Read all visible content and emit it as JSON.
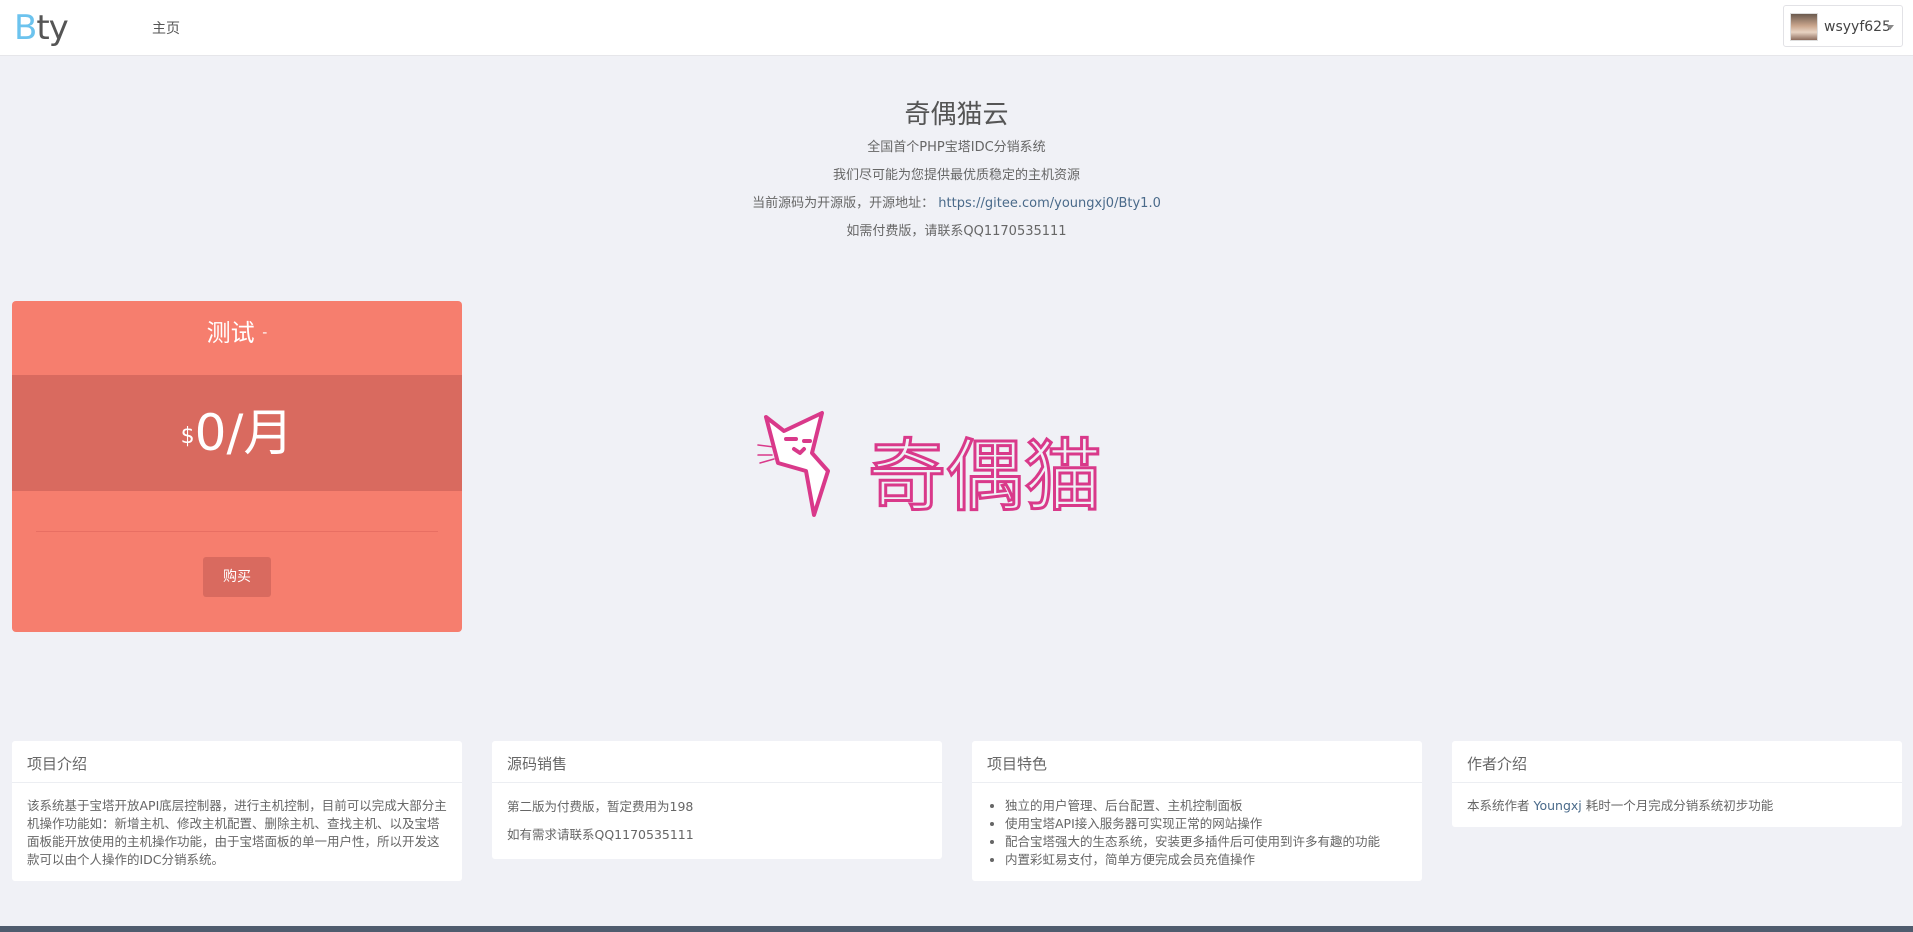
{
  "nav": {
    "logo_b": "B",
    "logo_rest": "ty",
    "home_label": "主页",
    "username": "wsyyf625"
  },
  "hero": {
    "title": "奇偶猫云",
    "line1": "全国首个PHP宝塔IDC分销系统",
    "line2": "我们尽可能为您提供最优质稳定的主机资源",
    "line3_prefix": "当前源码为开源版，开源地址：",
    "line3_link": "https://gitee.com/youngxj0/Bty1.0",
    "line4": "如需付费版，请联系QQ1170535111"
  },
  "price_card": {
    "title": "测试",
    "title_suffix": "-",
    "currency": "$",
    "price": "0/月",
    "buy_label": "购买",
    "colors": {
      "card": "#f67e6e",
      "band": "#d96a5f"
    }
  },
  "brand_logo": {
    "text": "奇偶猫",
    "color": "#d9398a"
  },
  "panels": {
    "intro": {
      "title": "项目介绍",
      "body": "该系统基于宝塔开放API底层控制器，进行主机控制，目前可以完成大部分主机操作功能如：新增主机、修改主机配置、删除主机、查找主机、以及宝塔面板能开放使用的主机操作功能，由于宝塔面板的单一用户性，所以开发这款可以由个人操作的IDC分销系统。"
    },
    "sales": {
      "title": "源码销售",
      "line1": "第二版为付费版，暂定费用为198",
      "line2": "如有需求请联系QQ1170535111"
    },
    "features": {
      "title": "项目特色",
      "items": [
        "独立的用户管理、后台配置、主机控制面板",
        "使用宝塔API接入服务器可实现正常的网站操作",
        "配合宝塔强大的生态系统，安装更多插件后可使用到许多有趣的功能",
        "内置彩虹易支付，简单方便完成会员充值操作"
      ]
    },
    "author": {
      "title": "作者介绍",
      "prefix": "本系统作者",
      "name": "Youngxj",
      "suffix": "耗时一个月完成分销系统初步功能"
    }
  }
}
